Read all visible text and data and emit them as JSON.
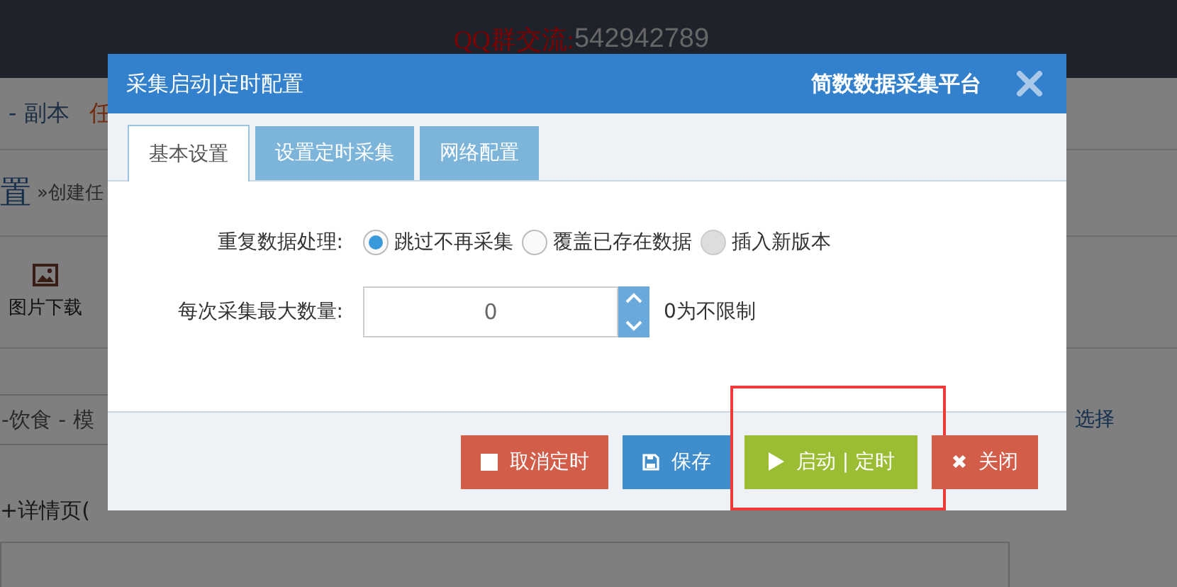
{
  "page": {
    "banner_label": "QQ群交流:",
    "banner_number": "542942789",
    "breadcrumb": "- 副本",
    "breadcrumb_cut": "任",
    "heading": "置",
    "heading_sub": "»创建任",
    "tool_label": "图片下载",
    "template_value": "-饮食 - 模",
    "choose_link": "选择",
    "mode_label": "+详情页("
  },
  "dialog": {
    "title": "采集启动|定时配置",
    "brand": "简数数据采集平台",
    "tabs": [
      {
        "label": "基本设置",
        "selected": true
      },
      {
        "label": "设置定时采集",
        "selected": false
      },
      {
        "label": "网络配置",
        "selected": false
      }
    ],
    "duplicate_label": "重复数据处理:",
    "duplicate_options": [
      {
        "label": "跳过不再采集",
        "selected": true,
        "disabled": false
      },
      {
        "label": "覆盖已存在数据",
        "selected": false,
        "disabled": false
      },
      {
        "label": "插入新版本",
        "selected": false,
        "disabled": true
      }
    ],
    "max_label": "每次采集最大数量:",
    "max_value": "0",
    "max_hint": "0为不限制",
    "buttons": [
      {
        "kind": "stop",
        "label": "取消定时",
        "highlighted": false
      },
      {
        "kind": "save",
        "label": "保存",
        "highlighted": false
      },
      {
        "kind": "play",
        "label": "启动 | 定时",
        "highlighted": true
      },
      {
        "kind": "close",
        "label": "关闭",
        "highlighted": false
      }
    ]
  }
}
